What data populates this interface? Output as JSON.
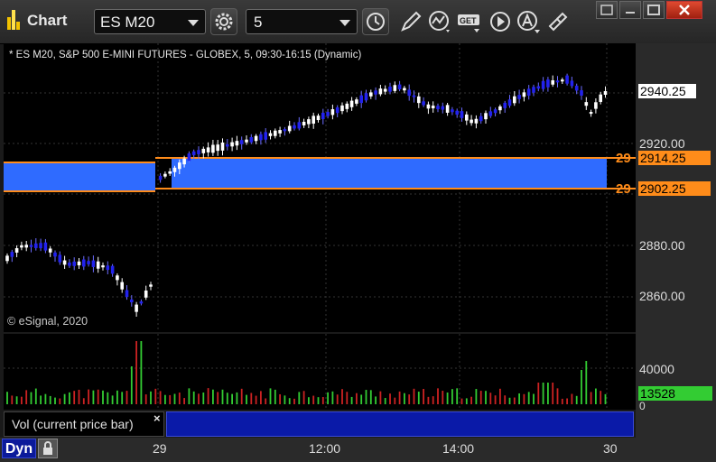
{
  "window": {
    "title": "Chart",
    "symbol": "ES M20",
    "interval": "5"
  },
  "chart": {
    "header": "* ES M20, S&P 500 E-MINI FUTURES - GLOBEX, 5, 09:30-16:15 (Dynamic)",
    "watermark": "© eSignal, 2020",
    "price_axis": [
      "2940.25",
      "2920.00",
      "2880.00",
      "2860.00"
    ],
    "last_price": "2940.25",
    "levels": [
      {
        "label": "29",
        "tag": "2914.25",
        "value": 2914.25
      },
      {
        "label": "29",
        "tag": "2902.25",
        "value": 2902.25
      }
    ],
    "colors": {
      "up": "#ffffff",
      "down": "#2222ee",
      "zone": "#2f6bff",
      "level_line": "#ff8c1a",
      "vol_up": "#33cc33",
      "vol_down": "#cc2222"
    }
  },
  "volume": {
    "label": "Vol (current price bar)",
    "close_glyph": "×",
    "axis": [
      "40000",
      "0"
    ],
    "current": "13528"
  },
  "time_axis": {
    "labels": [
      "29",
      "12:00",
      "14:00",
      "30"
    ],
    "mode_label": "Dyn"
  },
  "chart_data": {
    "type": "candlestick",
    "symbol": "ES M20",
    "interval": "5",
    "y_range": [
      2845,
      2952
    ],
    "x": [
      "29",
      "12:00",
      "14:00",
      "30"
    ],
    "horizontal_levels": [
      2914.25,
      2902.25
    ],
    "last": 2940.25,
    "volume_current": 13528,
    "volume_range": [
      0,
      40000
    ]
  }
}
